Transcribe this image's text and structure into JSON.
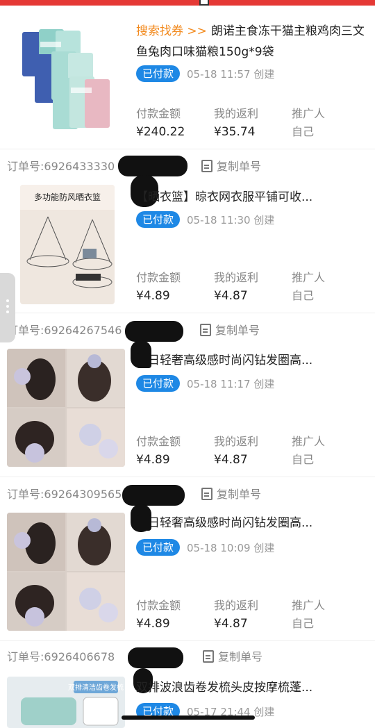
{
  "status_bar": {},
  "orders": [
    {
      "order_id": "",
      "copy_label": "",
      "tag": "搜索找券 >>",
      "title": "朗诺主食冻干猫主粮鸡肉三文鱼兔肉口味猫粮150g*9袋",
      "status": "已付款",
      "time": "05-18 11:57 创建",
      "pay_label": "付款金额",
      "pay_value": "¥240.22",
      "rebate_label": "我的返利",
      "rebate_value": "¥35.74",
      "promoter_label": "推广人",
      "promoter_value": "自己",
      "thumb_icon": "cat-food-bags-image"
    },
    {
      "order_id": "订单号:6926433330",
      "copy_label": "复制单号",
      "tag": "",
      "title": "【晒衣篮】晾衣网衣服平铺可收...",
      "status": "已付款",
      "time": "05-18 11:30 创建",
      "pay_label": "付款金额",
      "pay_value": "¥4.89",
      "rebate_label": "我的返利",
      "rebate_value": "¥4.87",
      "promoter_label": "推广人",
      "promoter_value": "自己",
      "thumb_caption": "多功能防风晒衣篮",
      "thumb_icon": "drying-basket-image"
    },
    {
      "order_id": "订单号:69264267546",
      "copy_label": "复制单号",
      "tag": "",
      "title": "夏日轻奢高级感时尚闪钻发圈高...",
      "status": "已付款",
      "time": "05-18 11:17 创建",
      "pay_label": "付款金额",
      "pay_value": "¥4.89",
      "rebate_label": "我的返利",
      "rebate_value": "¥4.87",
      "promoter_label": "推广人",
      "promoter_value": "自己",
      "thumb_icon": "hair-scrunchie-image"
    },
    {
      "order_id": "订单号:69264309565",
      "copy_label": "复制单号",
      "tag": "",
      "title": "夏日轻奢高级感时尚闪钻发圈高...",
      "status": "已付款",
      "time": "05-18 10:09 创建",
      "pay_label": "付款金额",
      "pay_value": "¥4.89",
      "rebate_label": "我的返利",
      "rebate_value": "¥4.87",
      "promoter_label": "推广人",
      "promoter_value": "自己",
      "thumb_icon": "hair-scrunchie-image"
    },
    {
      "order_id": "订单号:6926406678",
      "copy_label": "复制单号",
      "tag": "",
      "title": "双排波浪齿卷发梳头皮按摩梳蓬...",
      "status": "已付款",
      "time": "05-17 21:44 创建",
      "thumb_caption": "双排清洁齿卷发梳",
      "thumb_icon": "comb-image"
    }
  ],
  "colors": {
    "accent": "#1e88e5",
    "tag": "#f28a1e",
    "top_bar": "#e53935"
  }
}
